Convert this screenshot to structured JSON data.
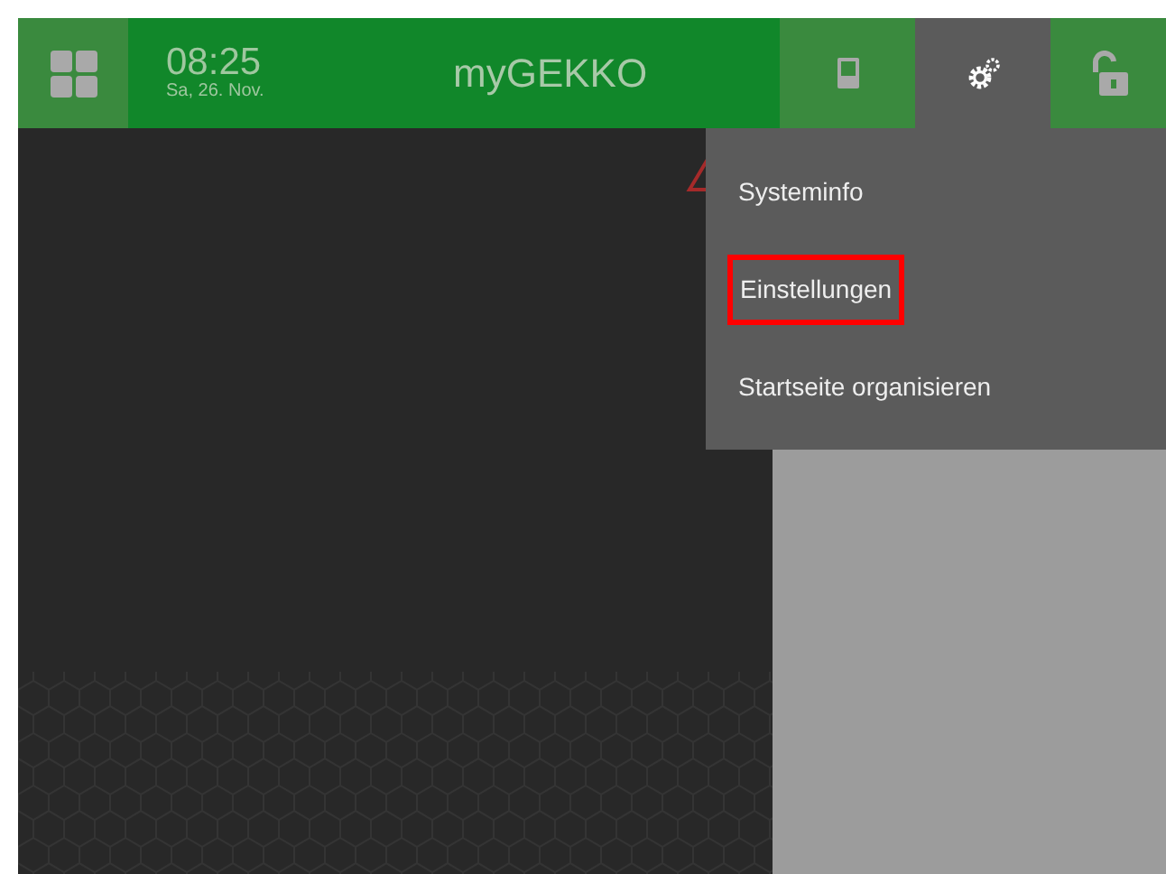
{
  "header": {
    "time": "08:25",
    "date": "Sa, 26. Nov.",
    "title": "myGEKKO",
    "buttons": [
      {
        "kind": "tablet",
        "selected": false
      },
      {
        "kind": "gears",
        "selected": true
      },
      {
        "kind": "lock",
        "selected": false
      }
    ]
  },
  "menu": {
    "items": [
      {
        "label": "Systeminfo",
        "highlighted": false
      },
      {
        "label": "Einstellungen",
        "highlighted": true
      },
      {
        "label": "Startseite organisieren",
        "highlighted": false
      }
    ]
  }
}
